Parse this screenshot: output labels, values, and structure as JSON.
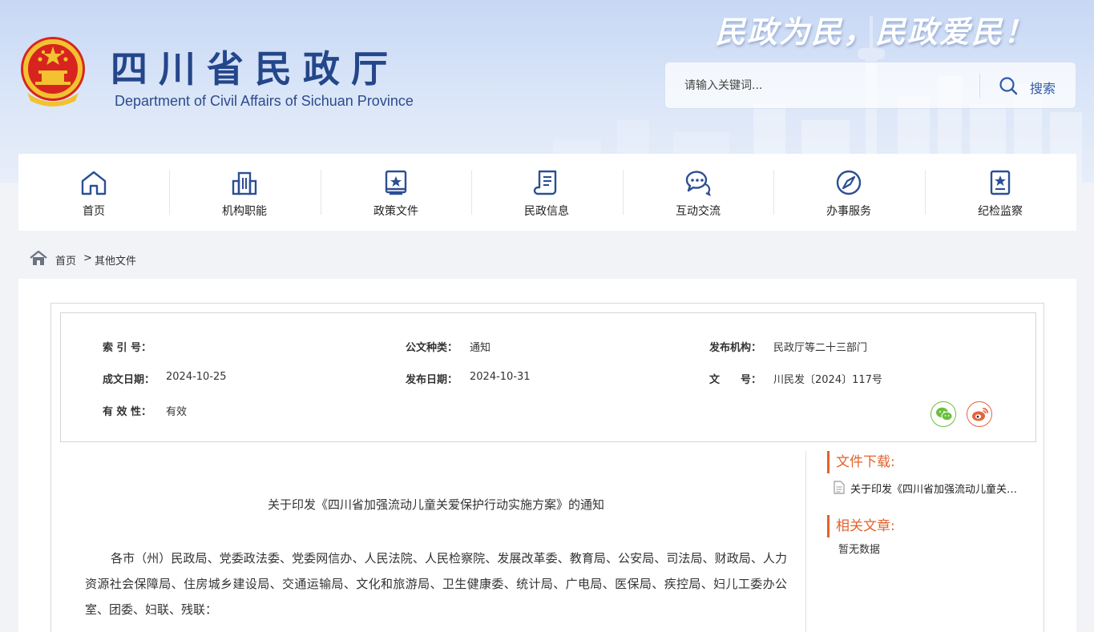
{
  "header": {
    "title": "四川省民政厅",
    "subtitle": "Department of Civil Affairs of Sichuan Province",
    "slogan": "民政为民，民政爱民！",
    "search": {
      "placeholder": "请输入关键词...",
      "button_label": "搜索"
    }
  },
  "nav": {
    "items": [
      {
        "label": "首页",
        "icon": "home-icon"
      },
      {
        "label": "机构职能",
        "icon": "building-icon"
      },
      {
        "label": "政策文件",
        "icon": "policy-book-icon"
      },
      {
        "label": "民政信息",
        "icon": "document-scroll-icon"
      },
      {
        "label": "互动交流",
        "icon": "chat-bubbles-icon"
      },
      {
        "label": "办事服务",
        "icon": "compass-icon"
      },
      {
        "label": "纪检监察",
        "icon": "badge-clipboard-icon"
      }
    ]
  },
  "breadcrumb": {
    "home": "首页",
    "separator": ">",
    "current": "其他文件"
  },
  "meta": {
    "index_label": "索 引 号：",
    "index_value": "",
    "type_label": "公文种类：",
    "type_value": "通知",
    "issuer_label": "发布机构：",
    "issuer_value": "民政厅等二十三部门",
    "written_label": "成文日期：",
    "written_value": "2024-10-25",
    "publish_label": "发布日期：",
    "publish_value": "2024-10-31",
    "docno_label": "文　　号：",
    "docno_value": "川民发〔2024〕117号",
    "validity_label": "有 效 性：",
    "validity_value": "有效"
  },
  "document": {
    "title": "关于印发《四川省加强流动儿童关爱保护行动实施方案》的通知",
    "body": "各市（州）民政局、党委政法委、党委网信办、人民法院、人民检察院、发展改革委、教育局、公安局、司法局、财政局、人力资源社会保障局、住房城乡建设局、交通运输局、文化和旅游局、卫生健康委、统计局、广电局、医保局、疾控局、妇儿工委办公室、团委、妇联、残联："
  },
  "sidebar": {
    "download_title": "文件下载:",
    "download_file": "关于印发《四川省加强流动儿童关爱保护行动实施方案》的通知",
    "related_title": "相关文章:",
    "related_empty": "暂无数据"
  },
  "colors": {
    "brand_blue": "#24468a",
    "accent_orange": "#e2622b",
    "wechat_green": "#6cbf3d",
    "weibo_red": "#e4643c"
  }
}
